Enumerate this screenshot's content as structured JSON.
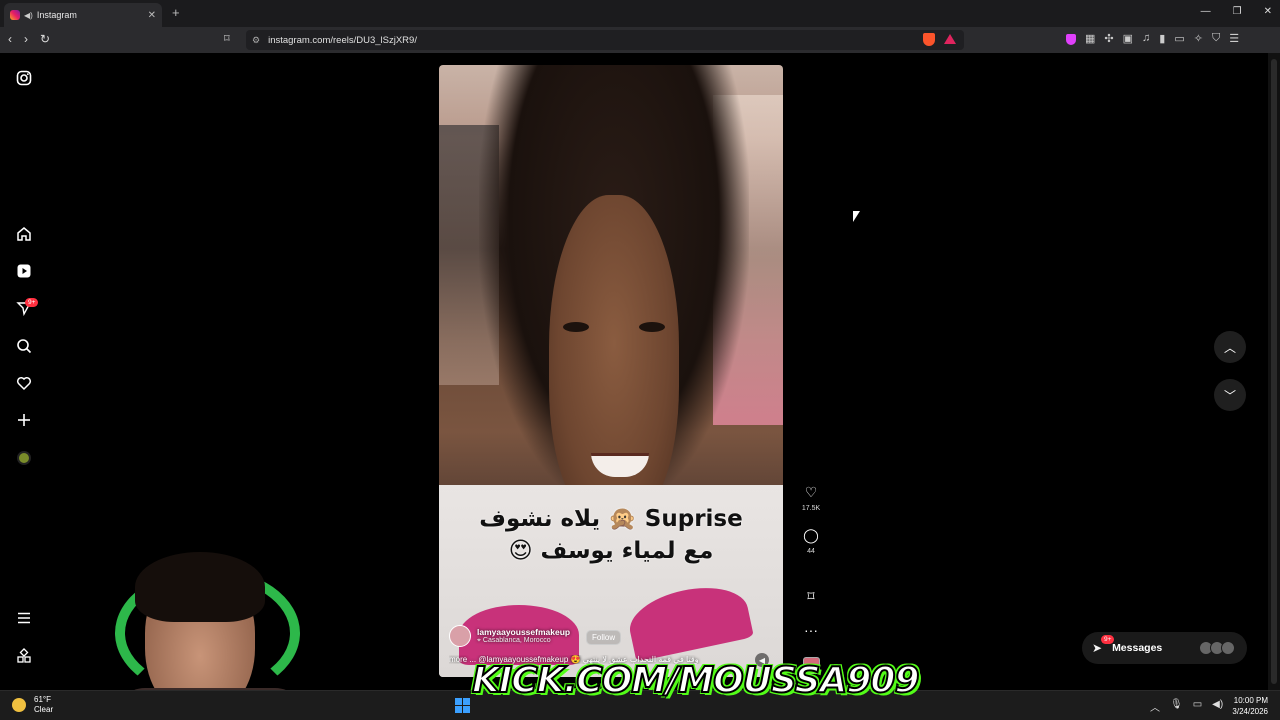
{
  "browser": {
    "tab_title": "Instagram",
    "url": "instagram.com/reels/DU3_lSzjXR9/"
  },
  "sidebar": {
    "notification_badge": "9+"
  },
  "reel": {
    "caption_line1": "Suprise 🙊 يلاه نشوف",
    "caption_line2": "مع لمياء يوسف 😍",
    "username": "lamyaayoussefmakeup",
    "location": "Casablanca, Morocco",
    "follow_label": "Follow",
    "description": "more ... @lamyaayoussefmakeup 😍 وقتا في قمة التحداب عشق لا ينتهي",
    "likes": "17.5K",
    "comments": "44"
  },
  "messages": {
    "label": "Messages",
    "badge": "9+"
  },
  "overlay": {
    "stream_text": "KICK.COM/MOUSSA909"
  },
  "taskbar": {
    "temperature": "61°F",
    "weather": "Clear",
    "time": "10:00 PM",
    "date": "3/24/2026"
  }
}
